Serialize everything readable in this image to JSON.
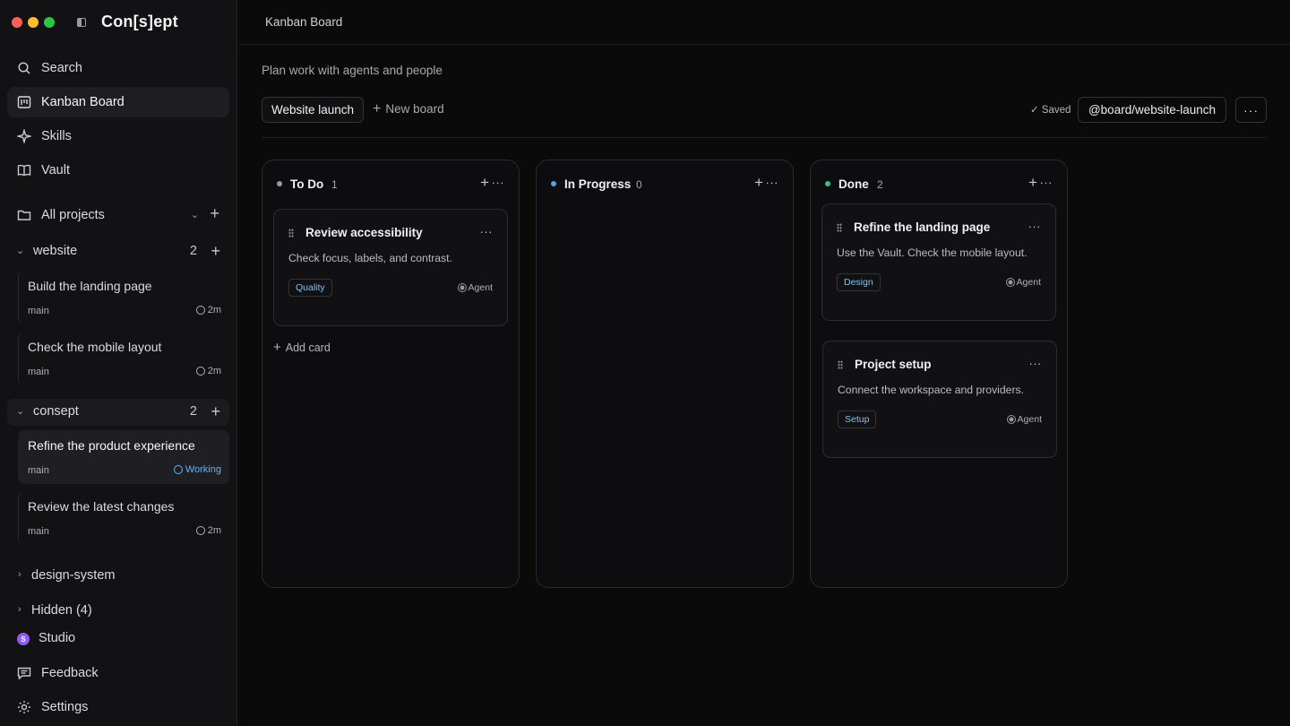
{
  "app": {
    "brand": "Con[s]ept"
  },
  "nav": {
    "search": "Search",
    "kanban": "Kanban Board",
    "skills": "Skills",
    "vault": "Vault"
  },
  "projects": {
    "all_label": "All projects",
    "groups": [
      {
        "label": "website",
        "count": "2"
      },
      {
        "label": "consept",
        "count": "2"
      }
    ],
    "threads": [
      {
        "title": "Build the landing page",
        "branch": "main",
        "status": "2m"
      },
      {
        "title": "Check the mobile layout",
        "branch": "main",
        "status": "2m"
      },
      {
        "title": "Refine the product experience",
        "branch": "main",
        "status": "Working"
      },
      {
        "title": "Review the latest changes",
        "branch": "main",
        "status": "2m"
      }
    ],
    "design_system": "design-system",
    "hidden": "Hidden (4)"
  },
  "footer": {
    "studio": "Studio",
    "studio_initial": "S",
    "feedback": "Feedback",
    "settings": "Settings"
  },
  "header": {
    "breadcrumb": "Kanban Board",
    "subtitle": "Plan work with agents and people"
  },
  "toolbar": {
    "board_tab": "Website launch",
    "new_board": "New board",
    "saved": "✓ Saved",
    "handle": "@board/website-launch",
    "more": "···"
  },
  "columns": [
    {
      "title": "To Do",
      "count": "1",
      "color": "#9a9aa2",
      "cards": [
        {
          "title": "Review accessibility",
          "desc": "Check focus, labels, and contrast.",
          "tag": "Quality",
          "agent": "Agent"
        }
      ],
      "add_card": "Add card"
    },
    {
      "title": "In Progress",
      "count": "0",
      "color": "#4ea8ea",
      "cards": []
    },
    {
      "title": "Done",
      "count": "2",
      "color": "#36c28a",
      "cards": [
        {
          "title": "Refine the landing page",
          "desc": "Use the Vault. Check the mobile layout.",
          "tag": "Design",
          "agent": "Agent"
        },
        {
          "title": "Project setup",
          "desc": "Connect the workspace and providers.",
          "tag": "Setup",
          "agent": "Agent"
        }
      ]
    }
  ],
  "colors": {
    "accent_blue": "#5eb6f2",
    "background": "#0a0a0b",
    "sidebar": "#121214"
  }
}
